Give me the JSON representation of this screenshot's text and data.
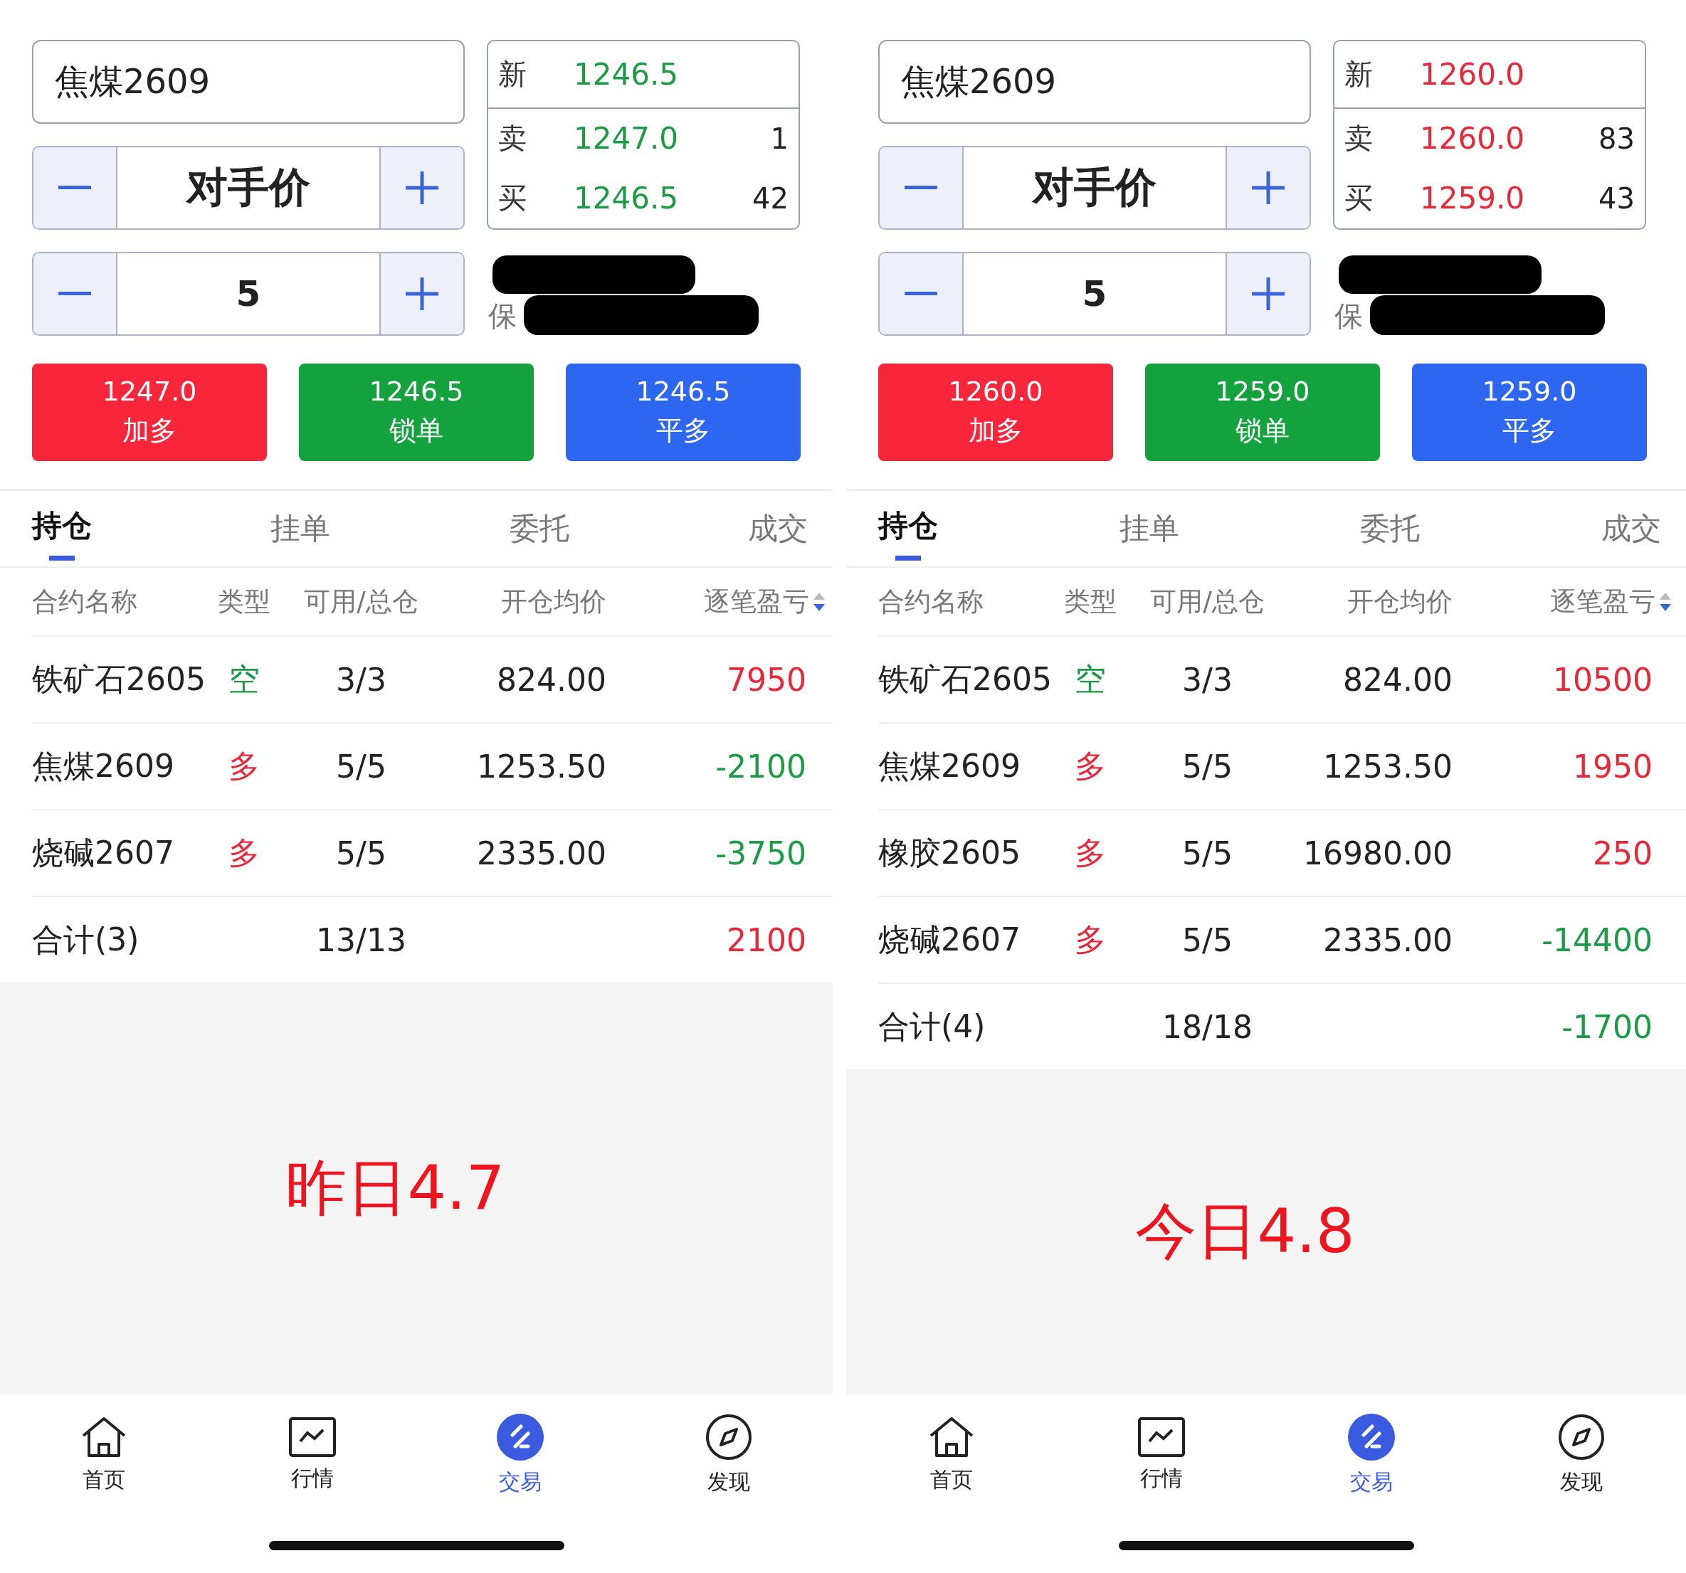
{
  "panels": [
    {
      "contract": "焦煤2609",
      "price_mode": "对手价",
      "quantity": "5",
      "color": "#1c9a46",
      "quote": [
        {
          "label": "新",
          "price": "1246.5"
        },
        {
          "label": "卖",
          "price": "1247.0",
          "volume": "1"
        },
        {
          "label": "买",
          "price": "1246.5",
          "volume": "42"
        }
      ],
      "account_fragment": "保",
      "order_buttons": [
        {
          "kind": "buy",
          "price": "1247.0",
          "label": "加多"
        },
        {
          "kind": "lock",
          "price": "1246.5",
          "label": "锁单"
        },
        {
          "kind": "close",
          "price": "1246.5",
          "label": "平多"
        }
      ],
      "tabs": [
        {
          "label": "持仓",
          "selected": true
        },
        {
          "label": "挂单",
          "selected": false
        },
        {
          "label": "委托",
          "selected": false
        },
        {
          "label": "成交",
          "selected": false
        }
      ],
      "columns": [
        "合约名称",
        "类型",
        "可用/总仓",
        "开仓均价",
        "逐笔盈亏"
      ],
      "rows": [
        {
          "name": "铁矿石2605",
          "kind": "short",
          "side": "空",
          "position": "3/3",
          "avg_price": "824.00",
          "pnl": "7950",
          "color": "#e5283a"
        },
        {
          "name": "焦煤2609",
          "kind": "long",
          "side": "多",
          "position": "5/5",
          "avg_price": "1253.50",
          "pnl": "-2100",
          "color": "#1c9a46"
        },
        {
          "name": "烧碱2607",
          "kind": "long",
          "side": "多",
          "position": "5/5",
          "avg_price": "2335.00",
          "pnl": "-3750",
          "color": "#1c9a46"
        }
      ],
      "total": {
        "label": "合计(3)",
        "position": "13/13",
        "pnl": "2100",
        "color": "#e5283a"
      },
      "note": "昨日4.7",
      "nav": [
        {
          "kind": "home",
          "label": "首页",
          "selected": false
        },
        {
          "kind": "chart",
          "label": "行情",
          "selected": false
        },
        {
          "kind": "trade",
          "label": "交易",
          "selected": true
        },
        {
          "kind": "compass",
          "label": "发现",
          "selected": false
        }
      ]
    },
    {
      "contract": "焦煤2609",
      "price_mode": "对手价",
      "quantity": "5",
      "color": "#e5283a",
      "quote": [
        {
          "label": "新",
          "price": "1260.0"
        },
        {
          "label": "卖",
          "price": "1260.0",
          "volume": "83"
        },
        {
          "label": "买",
          "price": "1259.0",
          "volume": "43"
        }
      ],
      "account_fragment": "保",
      "order_buttons": [
        {
          "kind": "buy",
          "price": "1260.0",
          "label": "加多"
        },
        {
          "kind": "lock",
          "price": "1259.0",
          "label": "锁单"
        },
        {
          "kind": "close",
          "price": "1259.0",
          "label": "平多"
        }
      ],
      "tabs": [
        {
          "label": "持仓",
          "selected": true
        },
        {
          "label": "挂单",
          "selected": false
        },
        {
          "label": "委托",
          "selected": false
        },
        {
          "label": "成交",
          "selected": false
        }
      ],
      "columns": [
        "合约名称",
        "类型",
        "可用/总仓",
        "开仓均价",
        "逐笔盈亏"
      ],
      "rows": [
        {
          "name": "铁矿石2605",
          "kind": "short",
          "side": "空",
          "position": "3/3",
          "avg_price": "824.00",
          "pnl": "10500",
          "color": "#e5283a"
        },
        {
          "name": "焦煤2609",
          "kind": "long",
          "side": "多",
          "position": "5/5",
          "avg_price": "1253.50",
          "pnl": "1950",
          "color": "#e5283a"
        },
        {
          "name": "橡胶2605",
          "kind": "long",
          "side": "多",
          "position": "5/5",
          "avg_price": "16980.00",
          "pnl": "250",
          "color": "#e5283a"
        },
        {
          "name": "烧碱2607",
          "kind": "long",
          "side": "多",
          "position": "5/5",
          "avg_price": "2335.00",
          "pnl": "-14400",
          "color": "#1c9a46"
        }
      ],
      "total": {
        "label": "合计(4)",
        "position": "18/18",
        "pnl": "-1700",
        "color": "#1c9a46"
      },
      "note": "今日4.8",
      "nav": [
        {
          "kind": "home",
          "label": "首页",
          "selected": false
        },
        {
          "kind": "chart",
          "label": "行情",
          "selected": false
        },
        {
          "kind": "trade",
          "label": "交易",
          "selected": true
        },
        {
          "kind": "compass",
          "label": "发现",
          "selected": false
        }
      ]
    }
  ]
}
